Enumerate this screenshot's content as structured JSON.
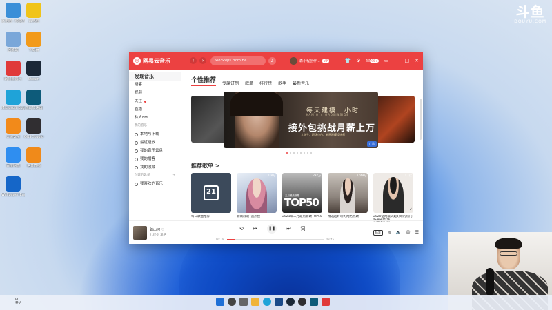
{
  "watermark": {
    "logo": "斗鱼",
    "sub": "DOUYU.COM"
  },
  "desktop_icons": [
    {
      "label": "此电脑 - 快捷方式",
      "color": "#3b8fd8"
    },
    {
      "label": "云电脑",
      "color": "#f0c419"
    },
    {
      "label": "回收站",
      "color": "#7aa7d9"
    },
    {
      "label": "下载器",
      "color": "#f29a1a"
    },
    {
      "label": "网易云音乐",
      "color": "#e03a3a"
    },
    {
      "label": "Steam",
      "color": "#1b2838"
    },
    {
      "label": "Microsoft Edge",
      "color": "#1fa3d8"
    },
    {
      "label": "游戏加速器",
      "color": "#0d5b7a"
    },
    {
      "label": "火绒安全",
      "color": "#f28a1a"
    },
    {
      "label": "OBS Studio",
      "color": "#302e31"
    },
    {
      "label": "百度网盘",
      "color": "#2f8ef0"
    },
    {
      "label": "语音直播",
      "color": "#f08a1a"
    },
    {
      "label": "Wallpaper Engine",
      "color": "#1566c8"
    }
  ],
  "app": {
    "logo": "网易云音乐",
    "search_placeholder": "Two Steps From He",
    "user_name": "森小程创作...",
    "vip": "VIP",
    "badge": "99+",
    "sidebar": {
      "items": [
        {
          "label": "发现音乐",
          "active": true
        },
        {
          "label": "播客"
        },
        {
          "label": "视频"
        },
        {
          "label": "关注",
          "dot": true
        },
        {
          "label": "直播"
        },
        {
          "label": "私人FM"
        }
      ],
      "my_music_head": "我的音乐",
      "my_music": [
        {
          "label": "本地与下载",
          "icon": "download-icon"
        },
        {
          "label": "最近播放",
          "icon": "clock-icon"
        },
        {
          "label": "我的音乐云盘",
          "icon": "cloud-icon"
        },
        {
          "label": "我的播客",
          "icon": "podcast-icon"
        },
        {
          "label": "我的收藏",
          "icon": "star-icon"
        }
      ],
      "created_head": "创建的歌单",
      "created_items": [
        {
          "label": "我喜欢的音乐",
          "icon": "heart-icon"
        }
      ]
    },
    "tabs": [
      "个性推荐",
      "专属订制",
      "歌单",
      "排行榜",
      "歌手",
      "最新音乐"
    ],
    "banner": {
      "line1": "每天建模一小时",
      "line2": "KAMIO × GAOXINSIDE",
      "line3": "接外包挑战月薪上万",
      "line4": "大学生、职场小白、新晋建模设计师",
      "tag": "广告"
    },
    "section_title": "推荐歌单 >",
    "playlists": [
      {
        "name": "每日歌曲推荐",
        "count": "",
        "cover": "calendar",
        "day": "21"
      },
      {
        "name": "新闻浪潮•追热搜",
        "count": "328万",
        "cover": "iu"
      },
      {
        "name": "2021年三月最热新歌TOP50",
        "count": "297万",
        "cover": "top50",
        "cover_text": "TOP50",
        "cover_sub": "三月最热新歌"
      },
      {
        "name": "精选超好听的网络热歌",
        "count": "1749万",
        "cover": "girl"
      },
      {
        "name": "2020全网最火超好听的热门歌曲推荐(持...",
        "count": "1.1亿",
        "cover": "boy"
      }
    ],
    "player": {
      "song": "踏山河",
      "artist": "七叔-叶泽浩",
      "time_current": "00:19",
      "time_total": "03:45",
      "progress": 0.08,
      "quality": "标准"
    }
  },
  "taskbar": {
    "left_text": [
      "PC",
      "开始"
    ]
  }
}
